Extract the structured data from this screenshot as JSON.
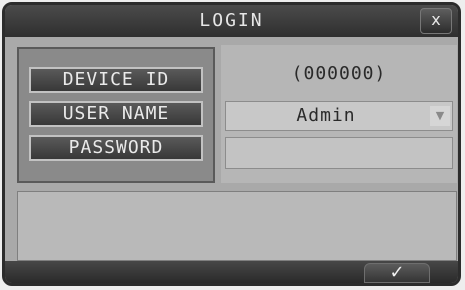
{
  "dialog": {
    "title": "LOGIN",
    "close_glyph": "x",
    "close_icon": "close-icon",
    "ok_glyph": "✓",
    "ok_icon": "checkmark-icon"
  },
  "labels": {
    "device_id": "DEVICE ID",
    "user_name": "USER NAME",
    "password": "PASSWORD"
  },
  "fields": {
    "device_id_value": "(000000)",
    "user_name_value": "Admin",
    "user_name_dropdown_glyph": "▼",
    "password_value": ""
  },
  "colors": {
    "background": "#a9a9a9",
    "titlebar": "#3a3a3a",
    "panel": "#b6b6b6"
  }
}
